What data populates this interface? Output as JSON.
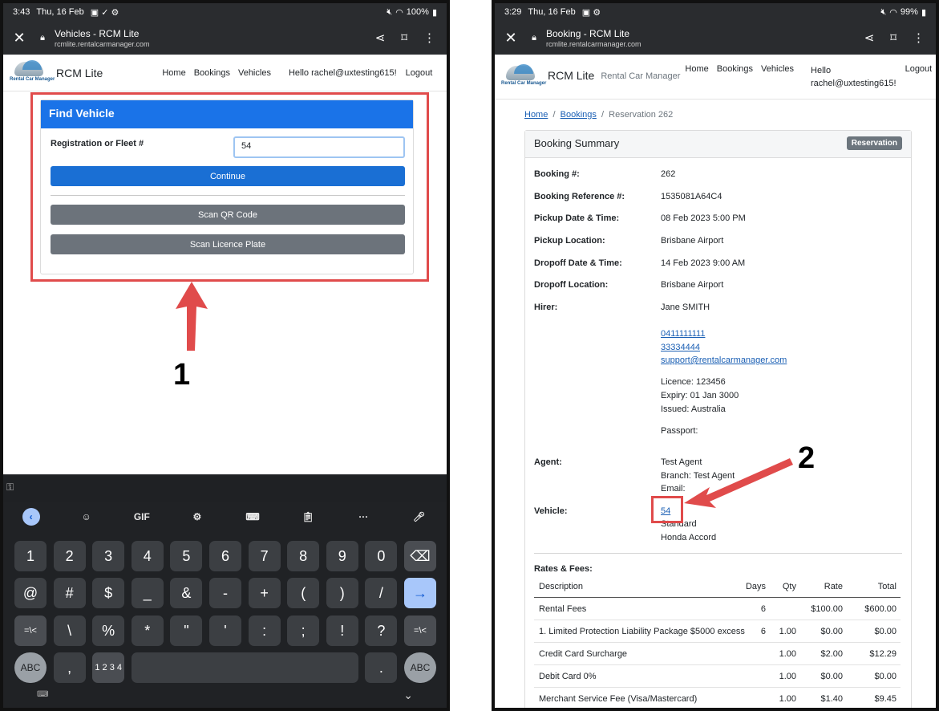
{
  "left": {
    "status": {
      "time": "3:43",
      "date": "Thu, 16 Feb",
      "battery": "100%"
    },
    "tab": {
      "title": "Vehicles - RCM Lite",
      "url": "rcmlite.rentalcarmanager.com"
    },
    "nav": {
      "logo_text": "Rental Car Manager",
      "brand": "RCM Lite",
      "links": [
        "Home",
        "Bookings",
        "Vehicles"
      ],
      "hello": "Hello rachel@uxtesting615!",
      "logout": "Logout"
    },
    "find": {
      "title": "Find Vehicle",
      "label": "Registration or Fleet #",
      "value": "54",
      "continue": "Continue",
      "scan_qr": "Scan QR Code",
      "scan_plate": "Scan Licence Plate"
    },
    "callout": "1",
    "keyboard": {
      "tools": [
        "GIF"
      ],
      "row1": [
        "1",
        "2",
        "3",
        "4",
        "5",
        "6",
        "7",
        "8",
        "9",
        "0"
      ],
      "row2": [
        "@",
        "#",
        "$",
        "_",
        "&",
        "-",
        "+",
        "(",
        ")",
        "/"
      ],
      "row3": [
        "=\\<",
        "\\",
        "%",
        "*",
        "\"",
        "'",
        ":",
        ";",
        "!",
        "?",
        "=\\<"
      ],
      "row4": {
        "abc": "ABC",
        "comma": ",",
        "frac": "1 2\n3 4",
        "period": ".",
        "abc2": "ABC"
      }
    }
  },
  "right": {
    "status": {
      "time": "3:29",
      "date": "Thu, 16 Feb",
      "battery": "99%"
    },
    "tab": {
      "title": "Booking - RCM Lite",
      "url": "rcmlite.rentalcarmanager.com"
    },
    "nav": {
      "logo_text": "Rental Car Manager",
      "brand": "RCM Lite",
      "brand_sub": "Rental Car Manager",
      "links": [
        "Home",
        "Bookings",
        "Vehicles"
      ],
      "hello1": "Hello",
      "hello2": "rachel@uxtesting615!",
      "logout": "Logout"
    },
    "breadcrumb": {
      "home": "Home",
      "bookings": "Bookings",
      "current": "Reservation 262"
    },
    "summary": {
      "title": "Booking Summary",
      "badge": "Reservation",
      "fields": {
        "booking_no_k": "Booking #:",
        "booking_no_v": "262",
        "ref_k": "Booking Reference #:",
        "ref_v": "1535081A64C4",
        "pickup_dt_k": "Pickup Date & Time:",
        "pickup_dt_v": "08 Feb 2023 5:00 PM",
        "pickup_loc_k": "Pickup Location:",
        "pickup_loc_v": "Brisbane Airport",
        "dropoff_dt_k": "Dropoff Date & Time:",
        "dropoff_dt_v": "14 Feb 2023 9:00 AM",
        "dropoff_loc_k": "Dropoff Location:",
        "dropoff_loc_v": "Brisbane Airport",
        "hirer_k": "Hirer:",
        "hirer_name": "Jane SMITH",
        "phone1": "0411111111",
        "phone2": "33334444",
        "email": "support@rentalcarmanager.com",
        "licence": "Licence: 123456",
        "expiry": "Expiry: 01 Jan 3000",
        "issued": "Issued: Australia",
        "passport": "Passport:",
        "agent_k": "Agent:",
        "agent_v": "Test Agent",
        "branch_v": "Branch: Test Agent",
        "agent_email": "Email:",
        "vehicle_k": "Vehicle:",
        "vehicle_link": "54",
        "vehicle_cat": "Standard",
        "vehicle_model": "Honda Accord"
      },
      "rates_title": "Rates & Fees:",
      "columns": [
        "Description",
        "Days",
        "Qty",
        "Rate",
        "Total"
      ],
      "rows": [
        [
          "Rental Fees",
          "6",
          "",
          "$100.00",
          "$600.00"
        ],
        [
          "1. Limited Protection Liability Package $5000 excess",
          "6",
          "1.00",
          "$0.00",
          "$0.00"
        ],
        [
          "Credit Card Surcharge",
          "",
          "1.00",
          "$2.00",
          "$12.29"
        ],
        [
          "Debit Card 0%",
          "",
          "1.00",
          "$0.00",
          "$0.00"
        ],
        [
          "Merchant Service Fee (Visa/Mastercard)",
          "",
          "1.00",
          "$1.40",
          "$9.45"
        ]
      ]
    },
    "callout": "2"
  },
  "colors": {
    "primary": "#1a6fd4",
    "header_blue": "#1a73e8",
    "annotation_red": "#e04b4b",
    "grey_button": "#6c737b",
    "browser_bar": "#2a2c2f"
  }
}
